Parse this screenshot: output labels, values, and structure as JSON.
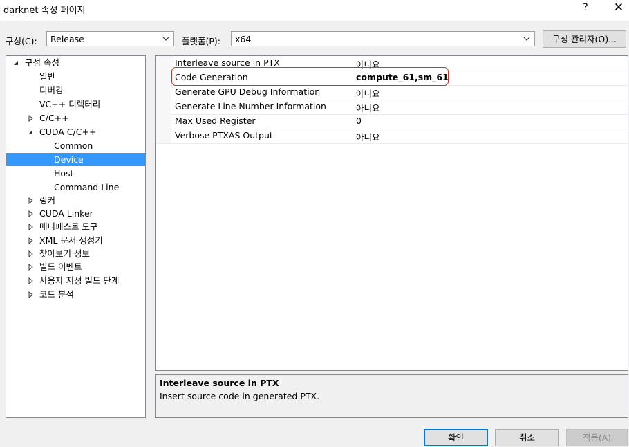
{
  "window": {
    "title": "darknet 속성 페이지",
    "help": "?",
    "close": "✕"
  },
  "config": {
    "config_label": "구성(C):",
    "config_value": "Release",
    "platform_label": "플랫폼(P):",
    "platform_value": "x64",
    "manager_button": "구성 관리자(O)..."
  },
  "tree": {
    "items": [
      {
        "label": "구성 속성",
        "state": "expanded"
      },
      {
        "label": "일반"
      },
      {
        "label": "디버깅"
      },
      {
        "label": "VC++ 디렉터리"
      },
      {
        "label": "C/C++",
        "state": "collapsed"
      },
      {
        "label": "CUDA C/C++",
        "state": "expanded"
      },
      {
        "label": "Common"
      },
      {
        "label": "Device",
        "selected": true
      },
      {
        "label": "Host"
      },
      {
        "label": "Command Line"
      },
      {
        "label": "링커",
        "state": "collapsed"
      },
      {
        "label": "CUDA Linker",
        "state": "collapsed"
      },
      {
        "label": "매니페스트 도구",
        "state": "collapsed"
      },
      {
        "label": "XML 문서 생성기",
        "state": "collapsed"
      },
      {
        "label": "찾아보기 정보",
        "state": "collapsed"
      },
      {
        "label": "빌드 이벤트",
        "state": "collapsed"
      },
      {
        "label": "사용자 지정 빌드 단계",
        "state": "collapsed"
      },
      {
        "label": "코드 분석",
        "state": "collapsed"
      }
    ]
  },
  "properties": [
    {
      "name": "Interleave source in PTX",
      "value": "아니요"
    },
    {
      "name": "Code Generation",
      "value": "compute_61,sm_61",
      "bold": true
    },
    {
      "name": "Generate GPU Debug Information",
      "value": "아니요"
    },
    {
      "name": "Generate Line Number Information",
      "value": "아니요"
    },
    {
      "name": "Max Used Register",
      "value": "0"
    },
    {
      "name": "Verbose PTXAS Output",
      "value": "아니요"
    }
  ],
  "description": {
    "title": "Interleave source in PTX",
    "text": "Insert source code in generated PTX."
  },
  "buttons": {
    "ok": "확인",
    "cancel": "취소",
    "apply": "적용(A)"
  },
  "colors": {
    "selection": "#3399ff",
    "highlight_border": "#c0392b",
    "primary_border": "#0078d7"
  }
}
